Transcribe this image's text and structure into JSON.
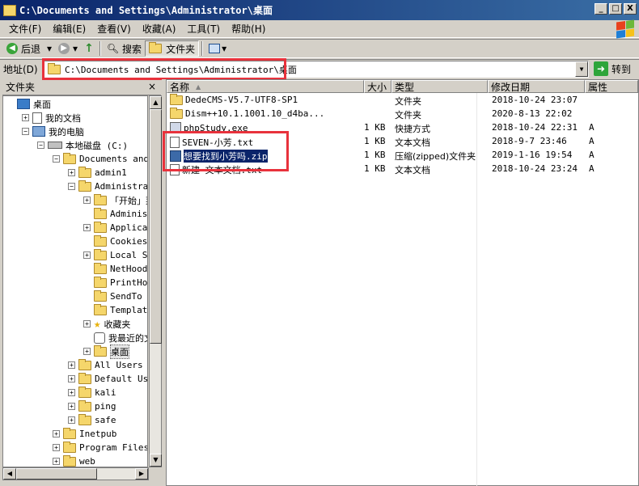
{
  "window": {
    "title": "C:\\Documents and Settings\\Administrator\\桌面",
    "buttons": [
      "_",
      "□",
      "X"
    ]
  },
  "menu": [
    "文件(F)",
    "编辑(E)",
    "查看(V)",
    "收藏(A)",
    "工具(T)",
    "帮助(H)"
  ],
  "toolbar": {
    "back": "后退",
    "back_drop": "▾",
    "forward_drop": "▾",
    "up": "↑",
    "search": "搜索",
    "folders": "文件夹",
    "view_drop": "▾"
  },
  "address": {
    "label": "地址(D)",
    "path": "C:\\Documents and Settings\\Administrator\\桌面",
    "go": "转到"
  },
  "left_pane": {
    "title": "文件夹",
    "close": "×",
    "tree": [
      {
        "label": "桌面",
        "pm": "",
        "icon": "desktop-icon",
        "sel": false
      },
      {
        "label": "我的文档",
        "pm": "+",
        "icon": "documents-icon",
        "sel": false
      },
      {
        "label": "我的电脑",
        "pm": "−",
        "icon": "computer-icon",
        "sel": false
      },
      {
        "label": "本地磁盘 (C:)",
        "pm": "−",
        "icon": "drive-icon",
        "sel": false
      },
      {
        "label": "Documents and Set",
        "pm": "−",
        "icon": "folder-icon",
        "sel": false
      },
      {
        "label": "admin1",
        "pm": "+",
        "icon": "folder-icon",
        "sel": false
      },
      {
        "label": "Administrator",
        "pm": "−",
        "icon": "folder-icon",
        "sel": false
      },
      {
        "label": "「开始」菜",
        "pm": "+",
        "icon": "folder-icon",
        "sel": false
      },
      {
        "label": "Administra",
        "pm": "",
        "icon": "folder-icon",
        "sel": false
      },
      {
        "label": "Applicatio",
        "pm": "+",
        "icon": "folder-icon",
        "sel": false
      },
      {
        "label": "Cookies",
        "pm": "",
        "icon": "folder-icon",
        "sel": false
      },
      {
        "label": "Local Sett",
        "pm": "+",
        "icon": "folder-icon",
        "sel": false
      },
      {
        "label": "NetHood",
        "pm": "",
        "icon": "folder-icon",
        "sel": false
      },
      {
        "label": "PrintHood",
        "pm": "",
        "icon": "folder-icon",
        "sel": false
      },
      {
        "label": "SendTo",
        "pm": "",
        "icon": "folder-icon",
        "sel": false
      },
      {
        "label": "Templates",
        "pm": "",
        "icon": "folder-icon",
        "sel": false
      },
      {
        "label": "收藏夹",
        "pm": "+",
        "icon": "favorites-icon",
        "sel": false
      },
      {
        "label": "我最近的文",
        "pm": "",
        "icon": "recent-icon",
        "sel": false
      },
      {
        "label": "桌面",
        "pm": "+",
        "icon": "folder-icon",
        "sel": true
      },
      {
        "label": "All Users",
        "pm": "+",
        "icon": "folder-icon",
        "sel": false
      },
      {
        "label": "Default User",
        "pm": "+",
        "icon": "folder-icon",
        "sel": false
      },
      {
        "label": "kali",
        "pm": "+",
        "icon": "folder-icon",
        "sel": false
      },
      {
        "label": "ping",
        "pm": "+",
        "icon": "folder-icon",
        "sel": false
      },
      {
        "label": "safe",
        "pm": "+",
        "icon": "folder-icon",
        "sel": false
      },
      {
        "label": "Inetpub",
        "pm": "+",
        "icon": "folder-icon",
        "sel": false
      },
      {
        "label": "Program Files",
        "pm": "+",
        "icon": "folder-icon",
        "sel": false
      },
      {
        "label": "web",
        "pm": "+",
        "icon": "folder-icon",
        "sel": false
      }
    ]
  },
  "file_list": {
    "columns": [
      "名称",
      "大小",
      "类型",
      "修改日期",
      "属性"
    ],
    "sort_indicator": "▲",
    "rows": [
      {
        "name": "DedeCMS-V5.7-UTF8-SP1",
        "size": "",
        "type": "文件夹",
        "date": "2018-10-24 23:07",
        "attr": "",
        "icon": "folder-icon",
        "selected": false
      },
      {
        "name": "Dism++10.1.1001.10_d4ba...",
        "size": "",
        "type": "文件夹",
        "date": "2020-8-13 22:02",
        "attr": "",
        "icon": "folder-icon",
        "selected": false
      },
      {
        "name": "phpStudy.exe",
        "size": "1 KB",
        "type": "快捷方式",
        "date": "2018-10-24 22:31",
        "attr": "A",
        "icon": "shortcut-icon",
        "selected": false
      },
      {
        "name": "SEVEN-小芳.txt",
        "size": "1 KB",
        "type": "文本文档",
        "date": "2018-9-7 23:46",
        "attr": "A",
        "icon": "text-file-icon",
        "selected": false
      },
      {
        "name": "想要找到小芳吗.zip",
        "size": "1 KB",
        "type": "压缩(zipped)文件夹",
        "date": "2019-1-16 19:54",
        "attr": "A",
        "icon": "zip-icon",
        "selected": true
      },
      {
        "name": "新建 文本文档.txt",
        "size": "1 KB",
        "type": "文本文档",
        "date": "2018-10-24 23:24",
        "attr": "A",
        "icon": "text-file-icon",
        "selected": false
      }
    ]
  },
  "colors": {
    "title_bar": "#0a246a",
    "selection": "#0a246a",
    "highlight_box": "#e8323c",
    "face": "#d4d0c8"
  }
}
